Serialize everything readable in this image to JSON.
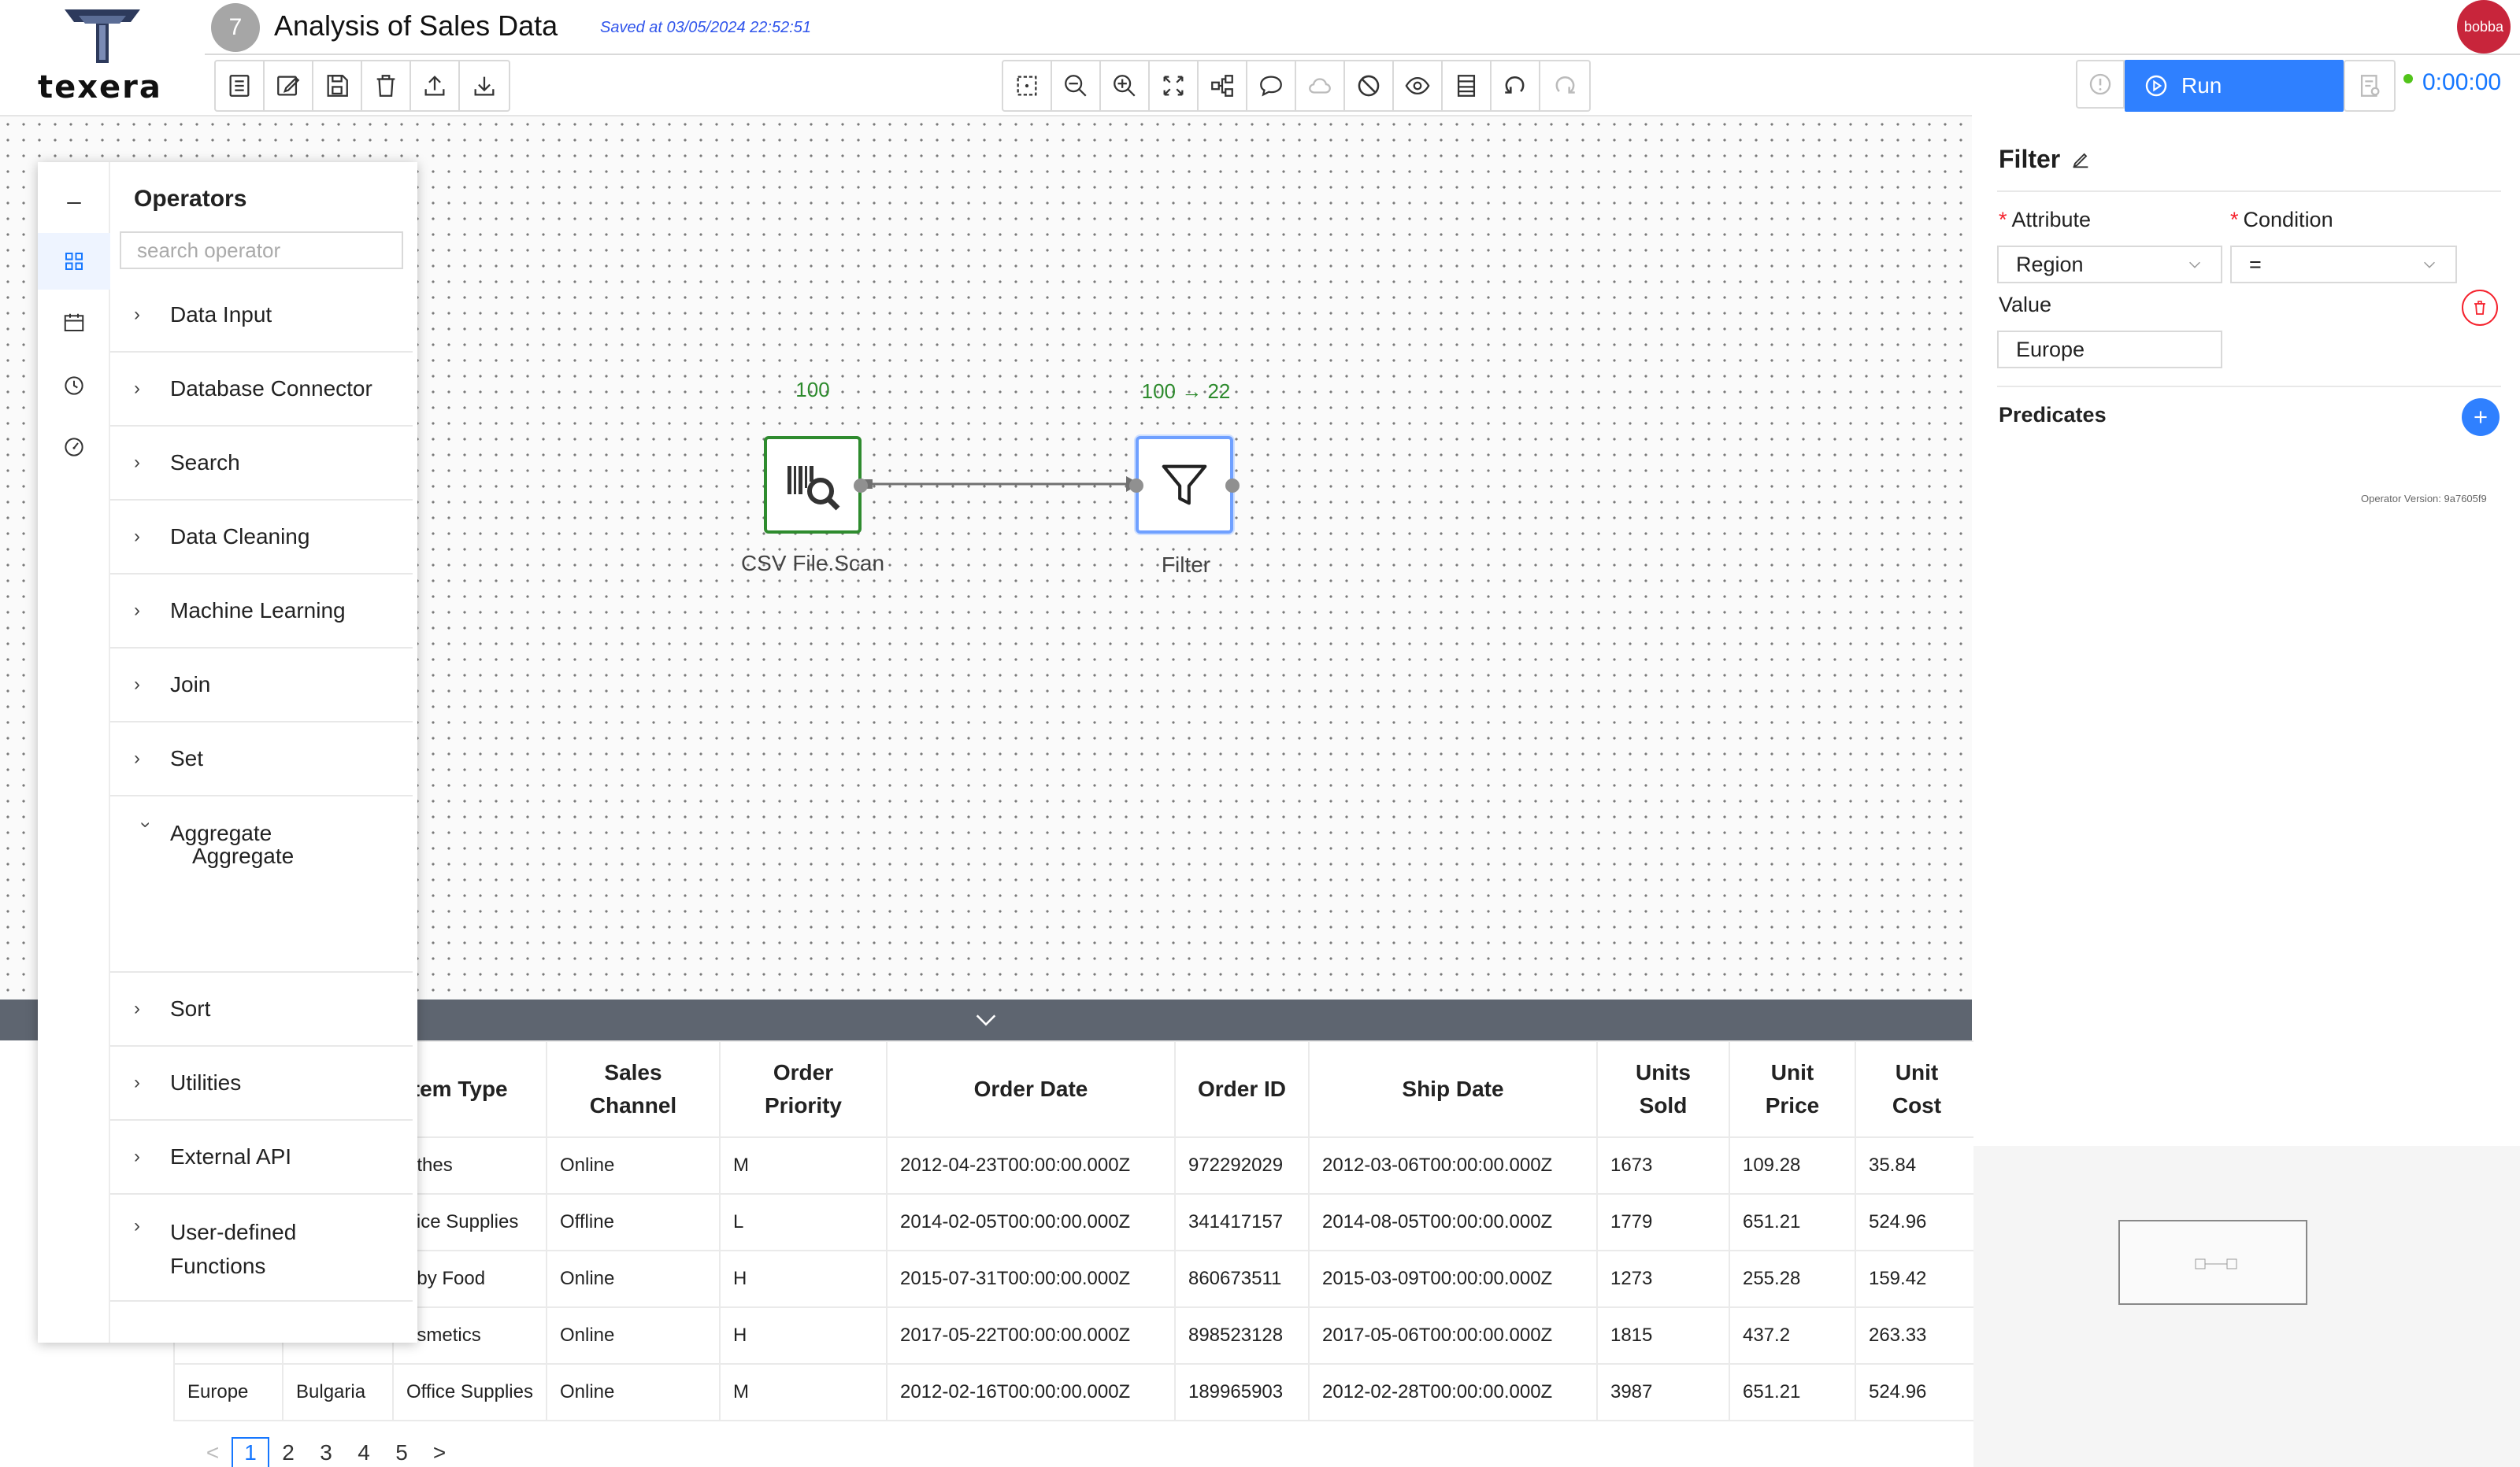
{
  "app": {
    "logo_text": "texera"
  },
  "header": {
    "workflow_id": "7",
    "title": "Analysis of Sales Data",
    "saved_at": "Saved at 03/05/2024 22:52:51",
    "user_avatar": "bobba",
    "run_label": "Run",
    "timer": "0:00:00"
  },
  "toolbar_left": [
    "list-icon",
    "edit-icon",
    "save-icon",
    "delete-icon",
    "upload-icon",
    "download-icon"
  ],
  "toolbar_center": [
    "select-icon",
    "zoom-out-icon",
    "zoom-in-icon",
    "fullscreen-icon",
    "layout-icon",
    "comment-icon",
    "cloud-icon",
    "disable-icon",
    "view-icon",
    "table-icon",
    "undo-icon",
    "redo-icon"
  ],
  "operators_panel": {
    "title": "Operators",
    "search_placeholder": "search operator",
    "categories": [
      "Data Input",
      "Database Connector",
      "Search",
      "Data Cleaning",
      "Machine Learning",
      "Join",
      "Set",
      "Aggregate",
      "Sort",
      "Utilities",
      "External API"
    ],
    "aggregate_child": "Aggregate",
    "udf_line1": "User-defined",
    "udf_line2": "Functions"
  },
  "workflow": {
    "scan": {
      "label": "CSV File.Scan",
      "count": "100"
    },
    "filter": {
      "label": "Filter",
      "count": "100 → 22"
    }
  },
  "property_panel": {
    "title": "Filter",
    "attribute_label": "Attribute",
    "attribute_value": "Region",
    "condition_label": "Condition",
    "condition_value": "=",
    "value_label": "Value",
    "value_value": "Europe",
    "predicates_label": "Predicates",
    "operator_version": "Operator Version: 9a7605f9"
  },
  "result_table": {
    "columns": [
      "Item Type",
      "Sales\nChannel",
      "Order\nPriority",
      "Order Date",
      "Order ID",
      "Ship Date",
      "Units\nSold",
      "Unit\nPrice",
      "Unit\nCost"
    ],
    "rows": [
      [
        "",
        "",
        "othes",
        "Online",
        "M",
        "2012-04-23T00:00:00.000Z",
        "972292029",
        "2012-03-06T00:00:00.000Z",
        "1673",
        "109.28",
        "35.84"
      ],
      [
        "",
        "",
        "ffice Supplies",
        "Offline",
        "L",
        "2014-02-05T00:00:00.000Z",
        "341417157",
        "2014-08-05T00:00:00.000Z",
        "1779",
        "651.21",
        "524.96"
      ],
      [
        "",
        "",
        "aby Food",
        "Online",
        "H",
        "2015-07-31T00:00:00.000Z",
        "860673511",
        "2015-03-09T00:00:00.000Z",
        "1273",
        "255.28",
        "159.42"
      ],
      [
        "",
        "",
        "osmetics",
        "Online",
        "H",
        "2017-05-22T00:00:00.000Z",
        "898523128",
        "2017-05-06T00:00:00.000Z",
        "1815",
        "437.2",
        "263.33"
      ],
      [
        "Europe",
        "Bulgaria",
        "Office Supplies",
        "Online",
        "M",
        "2012-02-16T00:00:00.000Z",
        "189965903",
        "2012-02-28T00:00:00.000Z",
        "3987",
        "651.21",
        "524.96"
      ]
    ]
  },
  "pager": {
    "prev": "<",
    "pages": [
      "1",
      "2",
      "3",
      "4",
      "5"
    ],
    "next": ">"
  }
}
